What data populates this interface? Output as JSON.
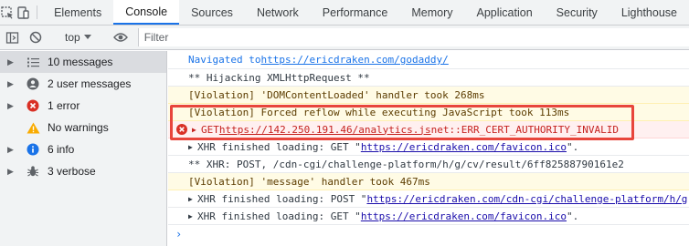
{
  "tabbar": {
    "tabs": [
      {
        "label": "Elements"
      },
      {
        "label": "Console"
      },
      {
        "label": "Sources"
      },
      {
        "label": "Network"
      },
      {
        "label": "Performance"
      },
      {
        "label": "Memory"
      },
      {
        "label": "Application"
      },
      {
        "label": "Security"
      },
      {
        "label": "Lighthouse"
      }
    ],
    "active": "Console",
    "icons": [
      "inspect-icon",
      "device-toolbar-icon"
    ]
  },
  "toolbar": {
    "context_label": "top",
    "filter_placeholder": "Filter",
    "icons": [
      "sidebar-toggle-icon",
      "clear-console-icon",
      "chevron-down-icon",
      "eye-icon"
    ]
  },
  "sidebar": {
    "items": [
      {
        "label": "10 messages",
        "icon": "list-icon"
      },
      {
        "label": "2 user messages",
        "icon": "user-icon"
      },
      {
        "label": "1 error",
        "icon": "error-icon"
      },
      {
        "label": "No warnings",
        "icon": "warning-icon"
      },
      {
        "label": "6 info",
        "icon": "info-icon"
      },
      {
        "label": "3 verbose",
        "icon": "bug-icon"
      }
    ]
  },
  "console": {
    "nav_prefix": "Navigated to ",
    "nav_url": "https://ericdraken.com/godaddy/",
    "line2": "** Hijacking XMLHttpRequest **",
    "line3": "[Violation] 'DOMContentLoaded' handler took 268ms",
    "line4": "[Violation] Forced reflow while executing JavaScript took 113ms",
    "err_method": "GET ",
    "err_url": "https://142.250.191.46/analytics.js",
    "err_msg": " net::ERR_CERT_AUTHORITY_INVALID",
    "line6_prefix": "XHR finished loading: GET \"",
    "line6_url": "https://ericdraken.com/favicon.ico",
    "line6_suffix": "\".",
    "line7": "** XHR: POST, /cdn-cgi/challenge-platform/h/g/cv/result/6ff82588790161e2",
    "line8": "[Violation] 'message' handler took 467ms",
    "line9_prefix": "XHR finished loading: POST \"",
    "line9_url": "https://ericdraken.com/cdn-cgi/challenge-platform/h/g",
    "line10_prefix": "XHR finished loading: GET \"",
    "line10_url": "https://ericdraken.com/favicon.ico",
    "line10_suffix": "\".",
    "prompt": "›"
  },
  "colors": {
    "accent": "#1a73e8",
    "error": "#d93025",
    "warning_bg": "#fffbe5",
    "highlight_box": "#e8453c"
  }
}
